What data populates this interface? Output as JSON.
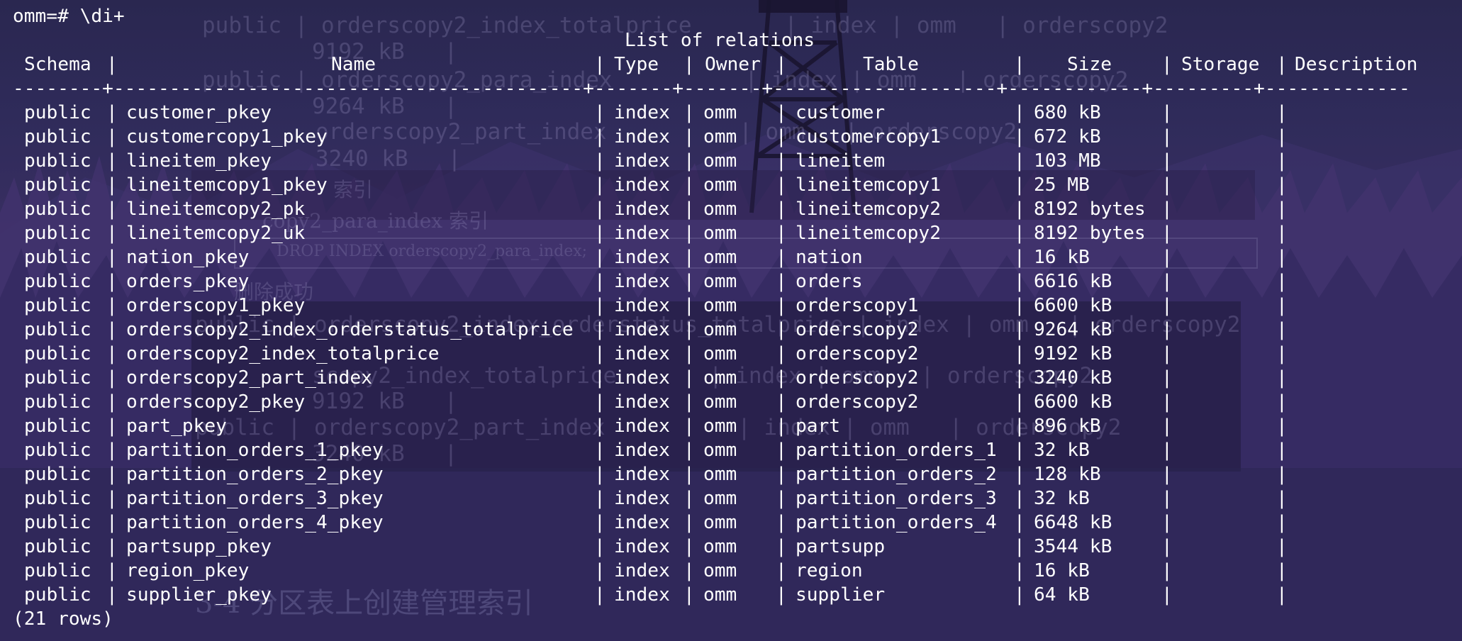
{
  "terminal": {
    "prompt": "omm=# \\di+",
    "table_title": "List of relations",
    "columns": [
      "Schema",
      "Name",
      "Type",
      "Owner",
      "Table",
      "Size",
      "Storage",
      "Description"
    ],
    "divider": "--------+------------------------------------------+-------+-------+--------------------+------------+---------+-------------",
    "rows": [
      [
        "public",
        "customer_pkey",
        "index",
        "omm",
        "customer",
        "680 kB",
        "",
        ""
      ],
      [
        "public",
        "customercopy1_pkey",
        "index",
        "omm",
        "customercopy1",
        "672 kB",
        "",
        ""
      ],
      [
        "public",
        "lineitem_pkey",
        "index",
        "omm",
        "lineitem",
        "103 MB",
        "",
        ""
      ],
      [
        "public",
        "lineitemcopy1_pkey",
        "index",
        "omm",
        "lineitemcopy1",
        "25 MB",
        "",
        ""
      ],
      [
        "public",
        "lineitemcopy2_pk",
        "index",
        "omm",
        "lineitemcopy2",
        "8192 bytes",
        "",
        ""
      ],
      [
        "public",
        "lineitemcopy2_uk",
        "index",
        "omm",
        "lineitemcopy2",
        "8192 bytes",
        "",
        ""
      ],
      [
        "public",
        "nation_pkey",
        "index",
        "omm",
        "nation",
        "16 kB",
        "",
        ""
      ],
      [
        "public",
        "orders_pkey",
        "index",
        "omm",
        "orders",
        "6616 kB",
        "",
        ""
      ],
      [
        "public",
        "orderscopy1_pkey",
        "index",
        "omm",
        "orderscopy1",
        "6600 kB",
        "",
        ""
      ],
      [
        "public",
        "orderscopy2_index_orderstatus_totalprice",
        "index",
        "omm",
        "orderscopy2",
        "9264 kB",
        "",
        ""
      ],
      [
        "public",
        "orderscopy2_index_totalprice",
        "index",
        "omm",
        "orderscopy2",
        "9192 kB",
        "",
        ""
      ],
      [
        "public",
        "orderscopy2_part_index",
        "index",
        "omm",
        "orderscopy2",
        "3240 kB",
        "",
        ""
      ],
      [
        "public",
        "orderscopy2_pkey",
        "index",
        "omm",
        "orderscopy2",
        "6600 kB",
        "",
        ""
      ],
      [
        "public",
        "part_pkey",
        "index",
        "omm",
        "part",
        "896 kB",
        "",
        ""
      ],
      [
        "public",
        "partition_orders_1_pkey",
        "index",
        "omm",
        "partition_orders_1",
        "32 kB",
        "",
        ""
      ],
      [
        "public",
        "partition_orders_2_pkey",
        "index",
        "omm",
        "partition_orders_2",
        "128 kB",
        "",
        ""
      ],
      [
        "public",
        "partition_orders_3_pkey",
        "index",
        "omm",
        "partition_orders_3",
        "32 kB",
        "",
        ""
      ],
      [
        "public",
        "partition_orders_4_pkey",
        "index",
        "omm",
        "partition_orders_4",
        "6648 kB",
        "",
        ""
      ],
      [
        "public",
        "partsupp_pkey",
        "index",
        "omm",
        "partsupp",
        "3544 kB",
        "",
        ""
      ],
      [
        "public",
        "region_pkey",
        "index",
        "omm",
        "region",
        "16 kB",
        "",
        ""
      ],
      [
        "public",
        "supplier_pkey",
        "index",
        "omm",
        "supplier",
        "64 kB",
        "",
        ""
      ]
    ],
    "row_count": "(21 rows)"
  },
  "background_document": {
    "ghost_lines": [
      "public | orderscopy2_index_totalprice       | index | omm   | orderscopy2",
      "9192 kB   |",
      "public | orderscopy2_para_index          | index | omm   | orderscopy2",
      "9264 kB   |",
      "orderscopy2_part_index          | omm   | orderscopy2",
      "3240 kB   |",
      "public | orderscopy2_index_orderstatus_totalprice | index | omm   | orderscopy2",
      "scopy2_index_totalprice       | index | omm   | orderscopy2",
      "9192 kB   |",
      "public | orderscopy2_part_index          | index | omm   | orderscopy2",
      "3240 kB   |"
    ],
    "ghost_cjk": [
      "索引",
      "copy2_para_index 索引",
      "DROP INDEX orderscopy2_para_index;",
      "删除成功",
      "3-4 分区表上创建管理索引"
    ]
  },
  "colors": {
    "terminal_text": "#ffffff",
    "background_top": "#2a2750",
    "background_mid": "#3b3270",
    "background_bottom": "#25234b"
  }
}
